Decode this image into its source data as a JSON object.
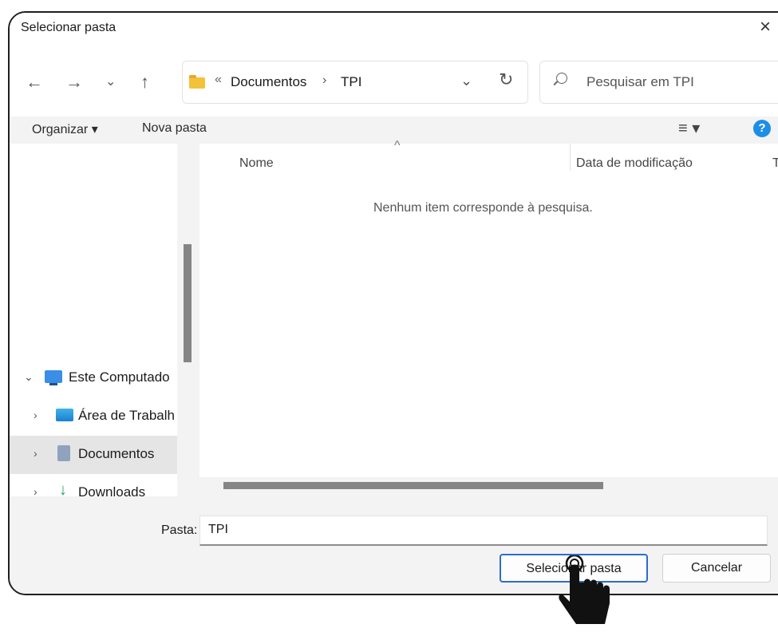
{
  "dialog": {
    "title": "Selecionar pasta",
    "close_icon": "×"
  },
  "nav": {
    "back": "←",
    "forward": "→",
    "recent": "⌄",
    "up": "↑"
  },
  "address": {
    "overflow": "«",
    "crumbs": [
      "Documentos",
      "TPI"
    ],
    "separator": "›",
    "dropdown": "⌄",
    "refresh": "↻"
  },
  "search": {
    "placeholder": "Pesquisar em TPI"
  },
  "toolbar": {
    "organize": "Organizar ▾",
    "new_folder": "Nova pasta",
    "view": "≡ ▾",
    "help": "?"
  },
  "tree": [
    {
      "label": "Este Computado",
      "chevron": "⌄",
      "icon": "computer-icon"
    },
    {
      "label": "Área de Trabalh",
      "chevron": "›",
      "icon": "desktop-folder-icon"
    },
    {
      "label": "Documentos",
      "chevron": "›",
      "icon": "documents-folder-icon",
      "selected": true
    },
    {
      "label": "Downloads",
      "chevron": "›",
      "icon": "downloads-icon"
    }
  ],
  "columns": {
    "name": "Nome",
    "sort_indicator": "^",
    "date": "Data de modificação",
    "extra": "T"
  },
  "empty_message": "Nenhum item corresponde à pesquisa.",
  "footer": {
    "folder_label": "Pasta:",
    "folder_value": "TPI",
    "select_button": "Selecionar pasta",
    "cancel_button": "Cancelar"
  },
  "colors": {
    "accent": "#2e6cc7",
    "help": "#1d8ee6",
    "folder": "#f3c23a"
  }
}
